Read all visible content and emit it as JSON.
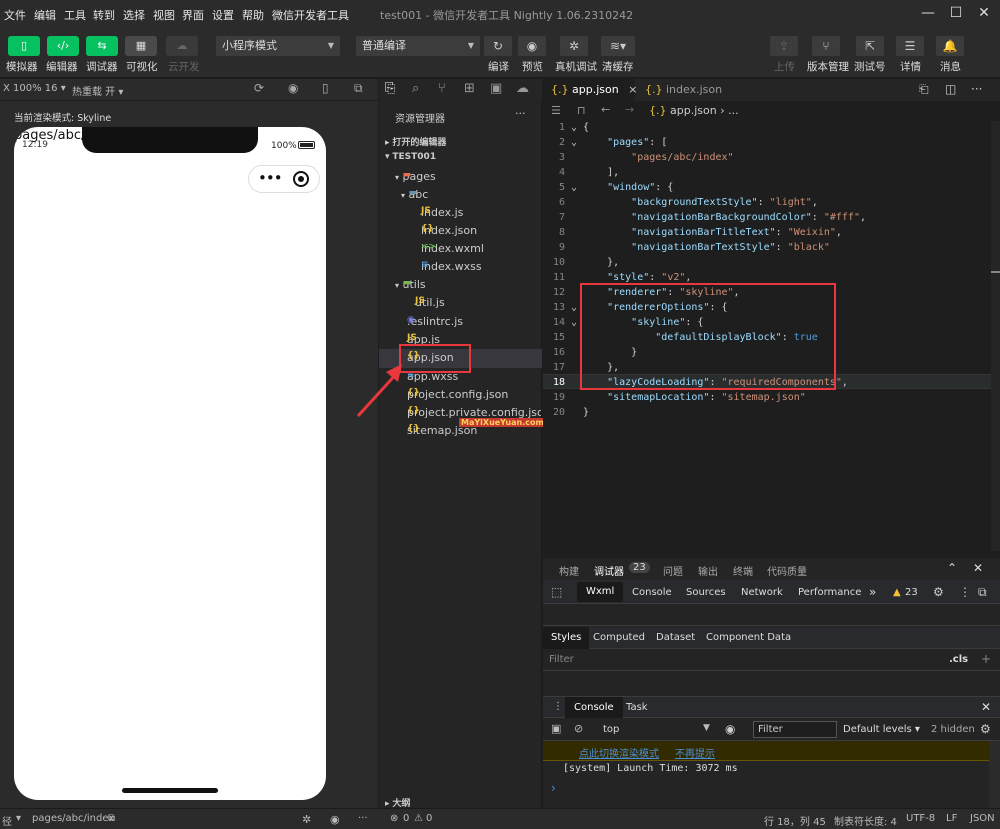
{
  "titlebar": {
    "menus": [
      "文件",
      "编辑",
      "工具",
      "转到",
      "选择",
      "视图",
      "界面",
      "设置",
      "帮助",
      "微信开发者工具"
    ],
    "title": "test001 - 微信开发者工具 Nightly 1.06.2310242"
  },
  "toolbar": {
    "left_buttons": [
      "模拟器",
      "编辑器",
      "调试器",
      "可视化",
      "云开发"
    ],
    "mode_select": "小程序模式",
    "compile_select": "普通编译",
    "actions": [
      "编译",
      "预览",
      "真机调试",
      "清缓存"
    ],
    "right_actions": [
      "上传",
      "版本管理",
      "测试号",
      "详情",
      "消息"
    ]
  },
  "simulator": {
    "zoom": "X 100% 16",
    "hot_reload": "热重载 开",
    "render_mode": "当前渲染模式: Skyline",
    "page_path": "pages/abc/",
    "time": "12:19",
    "battery": "100%"
  },
  "explorer": {
    "header": "资源管理器",
    "open_editors": "打开的编辑器",
    "project": "TEST001",
    "items": [
      {
        "label": "pages",
        "icon": "folder"
      },
      {
        "label": "abc",
        "icon": "folder"
      },
      {
        "label": "index.js",
        "icon": "js"
      },
      {
        "label": "index.json",
        "icon": "json"
      },
      {
        "label": "index.wxml",
        "icon": "wxml"
      },
      {
        "label": "index.wxss",
        "icon": "wxss"
      },
      {
        "label": "utils",
        "icon": "folder"
      },
      {
        "label": "util.js",
        "icon": "js"
      },
      {
        "label": ".eslintrc.js",
        "icon": "eslint"
      },
      {
        "label": "app.js",
        "icon": "js"
      },
      {
        "label": "app.json",
        "icon": "json"
      },
      {
        "label": "app.wxss",
        "icon": "wxss"
      },
      {
        "label": "project.config.json",
        "icon": "json"
      },
      {
        "label": "project.private.config.json",
        "icon": "json"
      },
      {
        "label": "sitemap.json",
        "icon": "json"
      }
    ],
    "outline": "大纲",
    "watermark_text": "MaYiXueYuan.com"
  },
  "editor": {
    "tabs": [
      "app.json",
      "index.json"
    ],
    "breadcrumb": "app.json",
    "breadcrumb_more": "...",
    "lines": [
      [
        [
          "p",
          "{"
        ]
      ],
      [
        [
          "p",
          "    "
        ],
        [
          "k",
          "\"pages\""
        ],
        [
          "p",
          ": ["
        ]
      ],
      [
        [
          "p",
          "        "
        ],
        [
          "s",
          "\"pages/abc/index\""
        ]
      ],
      [
        [
          "p",
          "    ],"
        ]
      ],
      [
        [
          "p",
          "    "
        ],
        [
          "k",
          "\"window\""
        ],
        [
          "p",
          ": {"
        ]
      ],
      [
        [
          "p",
          "        "
        ],
        [
          "k",
          "\"backgroundTextStyle\""
        ],
        [
          "p",
          ": "
        ],
        [
          "s",
          "\"light\""
        ],
        [
          "p",
          ","
        ]
      ],
      [
        [
          "p",
          "        "
        ],
        [
          "k",
          "\"navigationBarBackgroundColor\""
        ],
        [
          "p",
          ": "
        ],
        [
          "s",
          "\"#fff\""
        ],
        [
          "p",
          ","
        ]
      ],
      [
        [
          "p",
          "        "
        ],
        [
          "k",
          "\"navigationBarTitleText\""
        ],
        [
          "p",
          ": "
        ],
        [
          "s",
          "\"Weixin\""
        ],
        [
          "p",
          ","
        ]
      ],
      [
        [
          "p",
          "        "
        ],
        [
          "k",
          "\"navigationBarTextStyle\""
        ],
        [
          "p",
          ": "
        ],
        [
          "s",
          "\"black\""
        ]
      ],
      [
        [
          "p",
          "    },"
        ]
      ],
      [
        [
          "p",
          "    "
        ],
        [
          "k",
          "\"style\""
        ],
        [
          "p",
          ": "
        ],
        [
          "s",
          "\"v2\""
        ],
        [
          "p",
          ","
        ]
      ],
      [
        [
          "p",
          "    "
        ],
        [
          "k",
          "\"renderer\""
        ],
        [
          "p",
          ": "
        ],
        [
          "s",
          "\"skyline\""
        ],
        [
          "p",
          ","
        ]
      ],
      [
        [
          "p",
          "    "
        ],
        [
          "k",
          "\"rendererOptions\""
        ],
        [
          "p",
          ": {"
        ]
      ],
      [
        [
          "p",
          "        "
        ],
        [
          "k",
          "\"skyline\""
        ],
        [
          "p",
          ": {"
        ]
      ],
      [
        [
          "p",
          "            "
        ],
        [
          "k",
          "\"defaultDisplayBlock\""
        ],
        [
          "p",
          ": "
        ],
        [
          "b",
          "true"
        ]
      ],
      [
        [
          "p",
          "        }"
        ]
      ],
      [
        [
          "p",
          "    },"
        ]
      ],
      [
        [
          "p",
          "    "
        ],
        [
          "k",
          "\"lazyCodeLoading\""
        ],
        [
          "p",
          ": "
        ],
        [
          "s",
          "\"requiredComponents\""
        ],
        [
          "p",
          ","
        ]
      ],
      [
        [
          "p",
          "    "
        ],
        [
          "k",
          "\"sitemapLocation\""
        ],
        [
          "p",
          ": "
        ],
        [
          "s",
          "\"sitemap.json\""
        ]
      ],
      [
        [
          "p",
          "}"
        ]
      ]
    ]
  },
  "panel": {
    "top_tabs": [
      "构建",
      "调试器",
      "问题",
      "输出",
      "终端",
      "代码质量"
    ],
    "debug_badge": "23",
    "devtools_tabs": [
      "Wxml",
      "Console",
      "Sources",
      "Network",
      "Performance"
    ],
    "warning_count": "23",
    "style_tabs": [
      "Styles",
      "Computed",
      "Dataset",
      "Component Data"
    ],
    "filter_placeholder": "Filter",
    "cls": ".cls",
    "drawer_tabs": [
      "Console",
      "Task"
    ],
    "context": "top",
    "filter2": "Filter",
    "levels": "Default levels",
    "hidden": "2 hidden",
    "warning_links": [
      "点此切换渲染模式",
      "不再提示"
    ],
    "log_line": "[system] Launch Time: 3072 ms"
  },
  "statusbar": {
    "path_prefix": "径",
    "page": "pages/abc/index",
    "errors": "0",
    "warnings": "0",
    "cursor": "行 18，列 45",
    "tabsize": "制表符长度: 4",
    "encoding": "UTF-8",
    "eol": "LF",
    "lang": "JSON"
  },
  "colors": {
    "accent": "#07c160",
    "highlight": "#e8383d",
    "background": "#1e1e1e"
  }
}
